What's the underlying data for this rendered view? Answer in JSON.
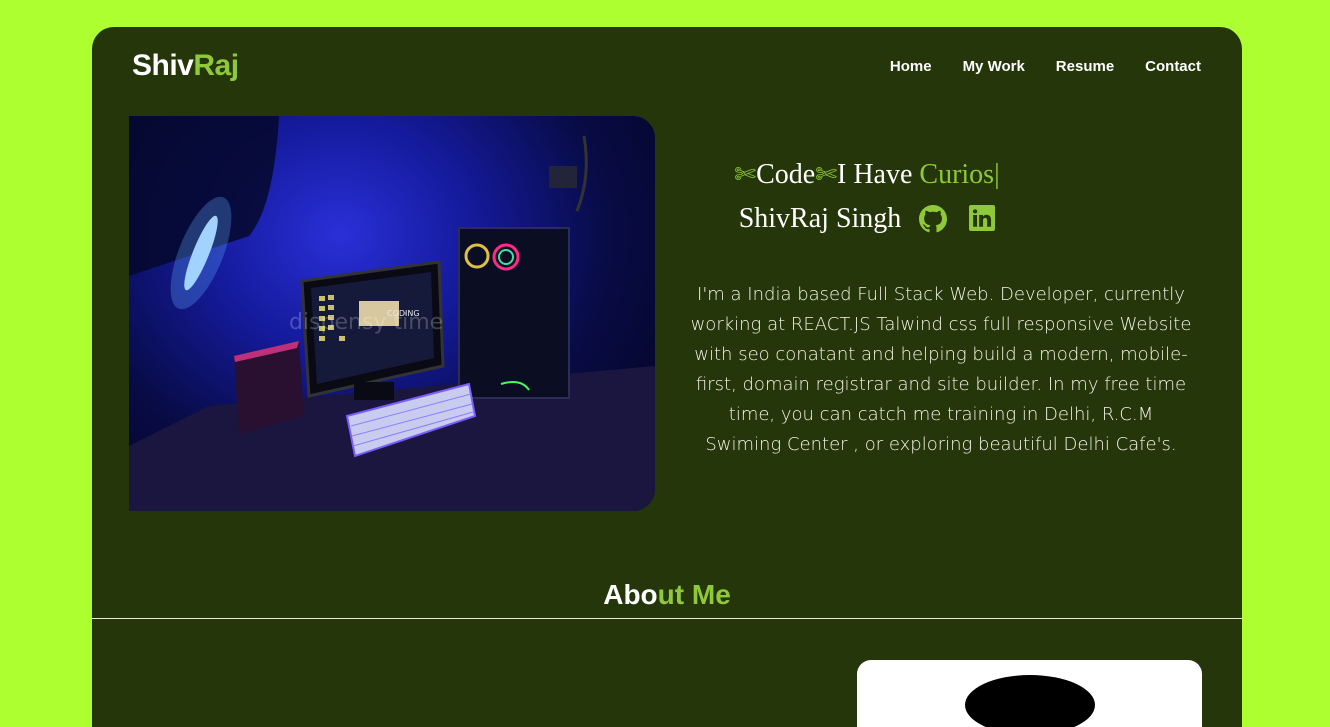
{
  "logo": {
    "part1": "Shiv",
    "part2": "Raj"
  },
  "nav": [
    {
      "label": "Home"
    },
    {
      "label": "My Work"
    },
    {
      "label": "Resume"
    },
    {
      "label": "Contact"
    }
  ],
  "hero": {
    "typer_code": "Code",
    "typer_have": "I Have ",
    "typer_curios": "Curios",
    "typer_cursor": "|",
    "scissors": "✄",
    "name": "ShivRaj Singh",
    "icons": {
      "github": "github-icon",
      "linkedin": "linkedin-icon"
    },
    "bio": "I'm a India based Full Stack Web. Developer, currently working at REACT.JS Talwind css full responsive Website with seo conatant and helping build a modern, mobile-first, domain registrar and site builder. In my free time time, you can catch me training in Delhi, R.C.M Swiming Center , or exploring beautiful Delhi Cafe's."
  },
  "photo": {
    "watermark": "dispensy time",
    "screen_text": "CODING"
  },
  "about": {
    "part1": "Abo",
    "part2": "ut Me"
  },
  "colors": {
    "page_bg": "#adff2f",
    "card_bg": "#25370a",
    "accent": "#8fc93a"
  }
}
